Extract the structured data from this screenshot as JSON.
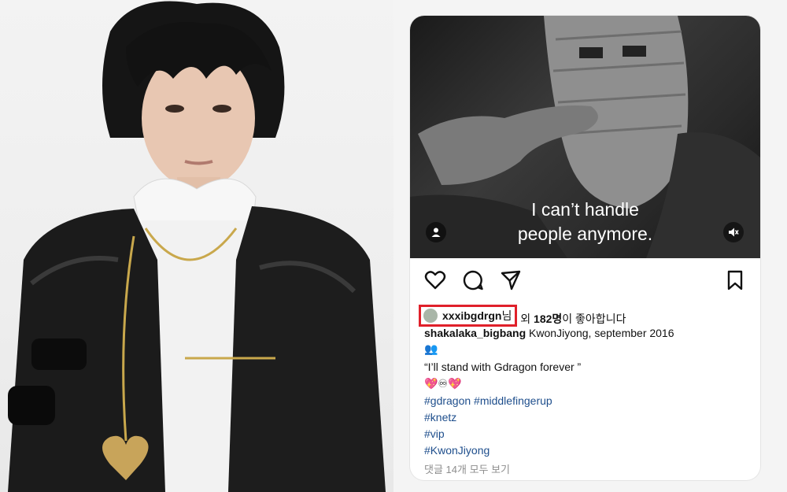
{
  "video": {
    "subtitle_line1": "I can’t handle",
    "subtitle_line2": "people anymore."
  },
  "post": {
    "liker_username": "xxxibgdrgn",
    "liker_suffix": "님",
    "likes_middle": " 외 ",
    "likes_count": "182명",
    "likes_end": "이 좋아합니다",
    "author": "shakalaka_bigbang",
    "caption_text": " KwonJiyong, september 2016",
    "caption_emoji_1": "👥",
    "quote": "“I’ll stand with Gdragon forever ”",
    "caption_emoji_2": "💖♾💖",
    "hashtags": [
      "#gdragon #middlefingerup",
      "#knetz",
      "#vip",
      "#KwonJiyong"
    ],
    "view_comments": "댓글 14개 모두 보기"
  },
  "icons": [
    "heart-icon",
    "comment-icon",
    "share-icon",
    "bookmark-icon",
    "user-icon",
    "mute-icon"
  ],
  "colors": {
    "hashtag": "#1e4e8c",
    "highlight": "#e0202a",
    "meta": "#8e8e8e"
  }
}
